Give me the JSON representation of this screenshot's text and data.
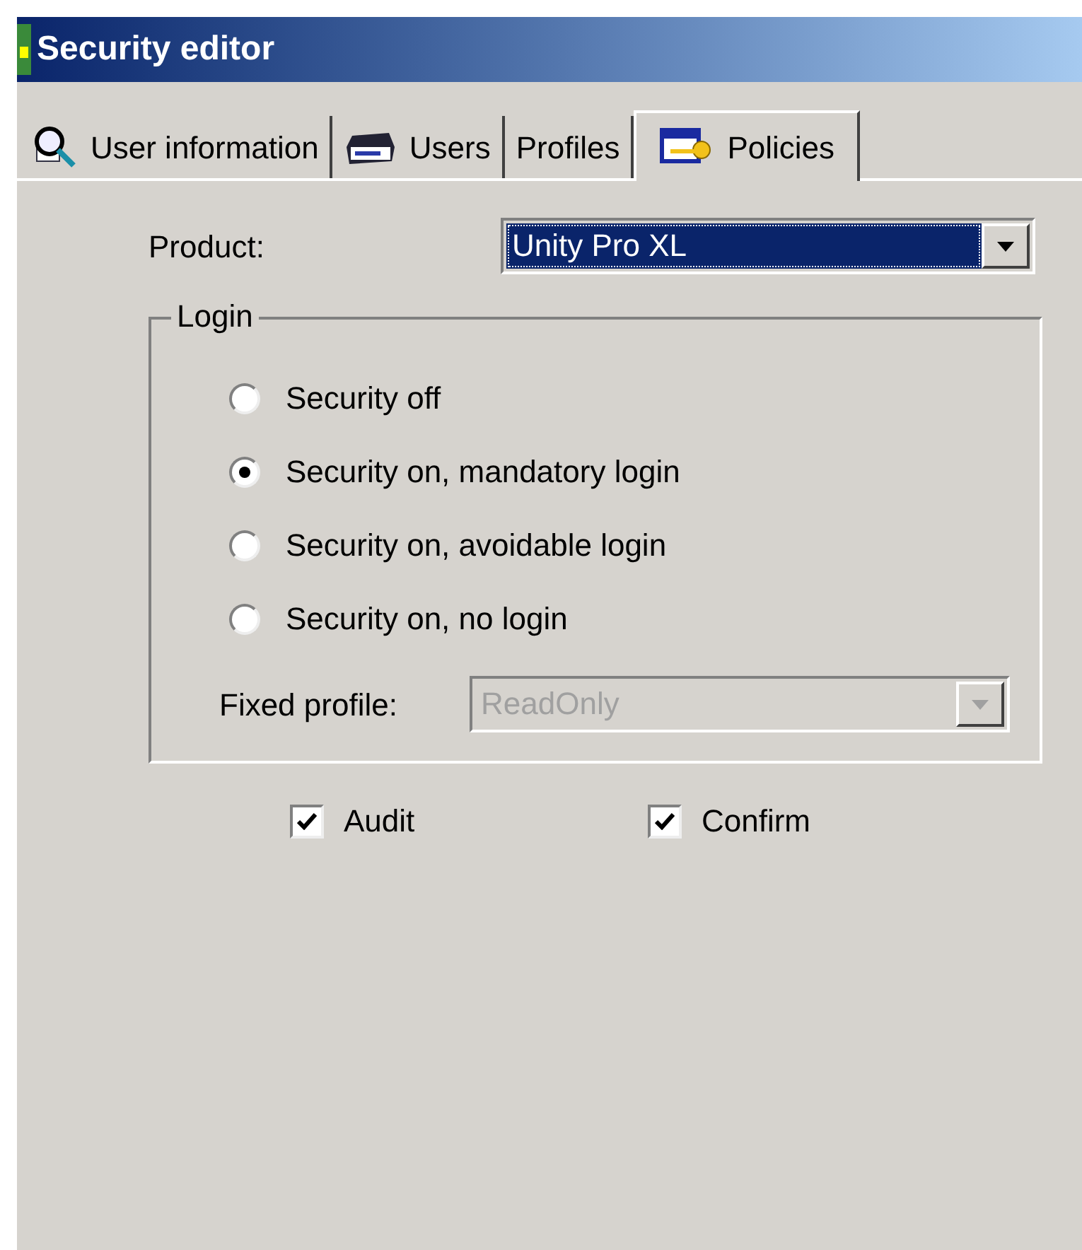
{
  "window": {
    "title": "Security editor"
  },
  "tabs": [
    {
      "label": "User information",
      "kind": "magnifier",
      "selected": false
    },
    {
      "label": "Users",
      "kind": "drive",
      "selected": false
    },
    {
      "label": "Profiles",
      "kind": "plain",
      "selected": false
    },
    {
      "label": "Policies",
      "kind": "key",
      "selected": true
    }
  ],
  "product": {
    "label": "Product:",
    "value": "Unity Pro XL",
    "focused": true
  },
  "login": {
    "legend": "Login",
    "options": [
      {
        "label": "Security off",
        "selected": false
      },
      {
        "label": "Security on, mandatory login",
        "selected": true
      },
      {
        "label": "Security on, avoidable login",
        "selected": false
      },
      {
        "label": "Security on, no login",
        "selected": false
      }
    ],
    "fixed_profile": {
      "label": "Fixed profile:",
      "value": "ReadOnly",
      "disabled": true
    }
  },
  "checkboxes": [
    {
      "label": "Audit",
      "checked": true
    },
    {
      "label": "Confirm",
      "checked": true
    }
  ]
}
